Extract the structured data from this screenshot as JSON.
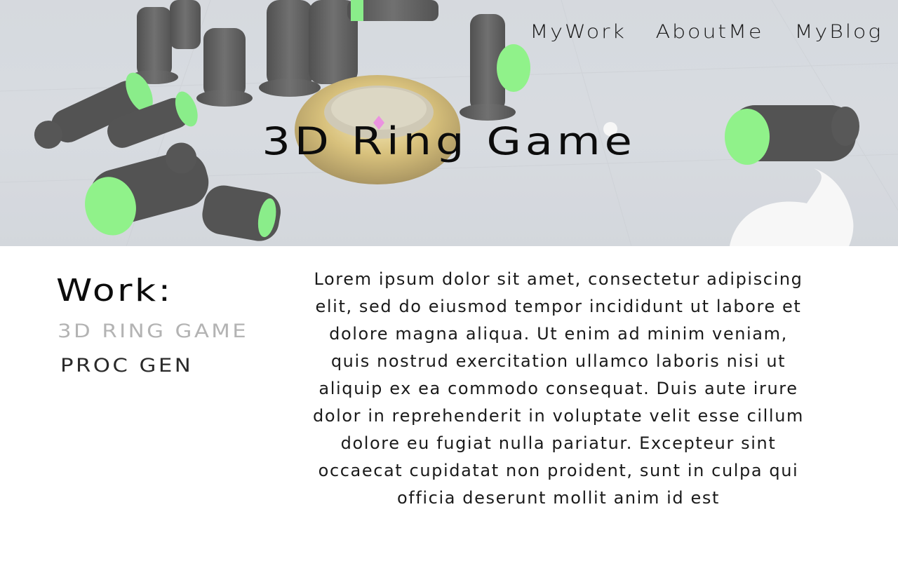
{
  "nav": {
    "items": [
      {
        "label": "MyWork"
      },
      {
        "label": "AboutMe"
      },
      {
        "label": "MyBlog"
      }
    ]
  },
  "hero": {
    "title": "3D Ring Game",
    "background_image": "chess-pieces-with-gold-ring-scene"
  },
  "sidebar": {
    "heading": "Work:",
    "items": [
      {
        "label": "3D RING GAME",
        "state": "active"
      },
      {
        "label": "PROC GEN",
        "state": "normal"
      }
    ]
  },
  "main": {
    "body": "Lorem ipsum dolor sit amet, consectetur adipiscing elit, sed do eiusmod tempor incididunt ut labore et dolore magna aliqua. Ut enim ad minim veniam, quis nostrud exercitation ullamco laboris nisi ut aliquip ex ea commodo consequat. Duis aute irure dolor in reprehenderit in voluptate velit esse cillum dolore eu fugiat nulla pariatur. Excepteur sint occaecat cupidatat non proident, sunt in culpa qui officia deserunt mollit anim id est"
  },
  "colors": {
    "accent_green": "#6be86b",
    "piece_black": "#1c1c1c",
    "ring_gold": "#c9a94a",
    "active_item_gray": "#b3b3b3"
  }
}
